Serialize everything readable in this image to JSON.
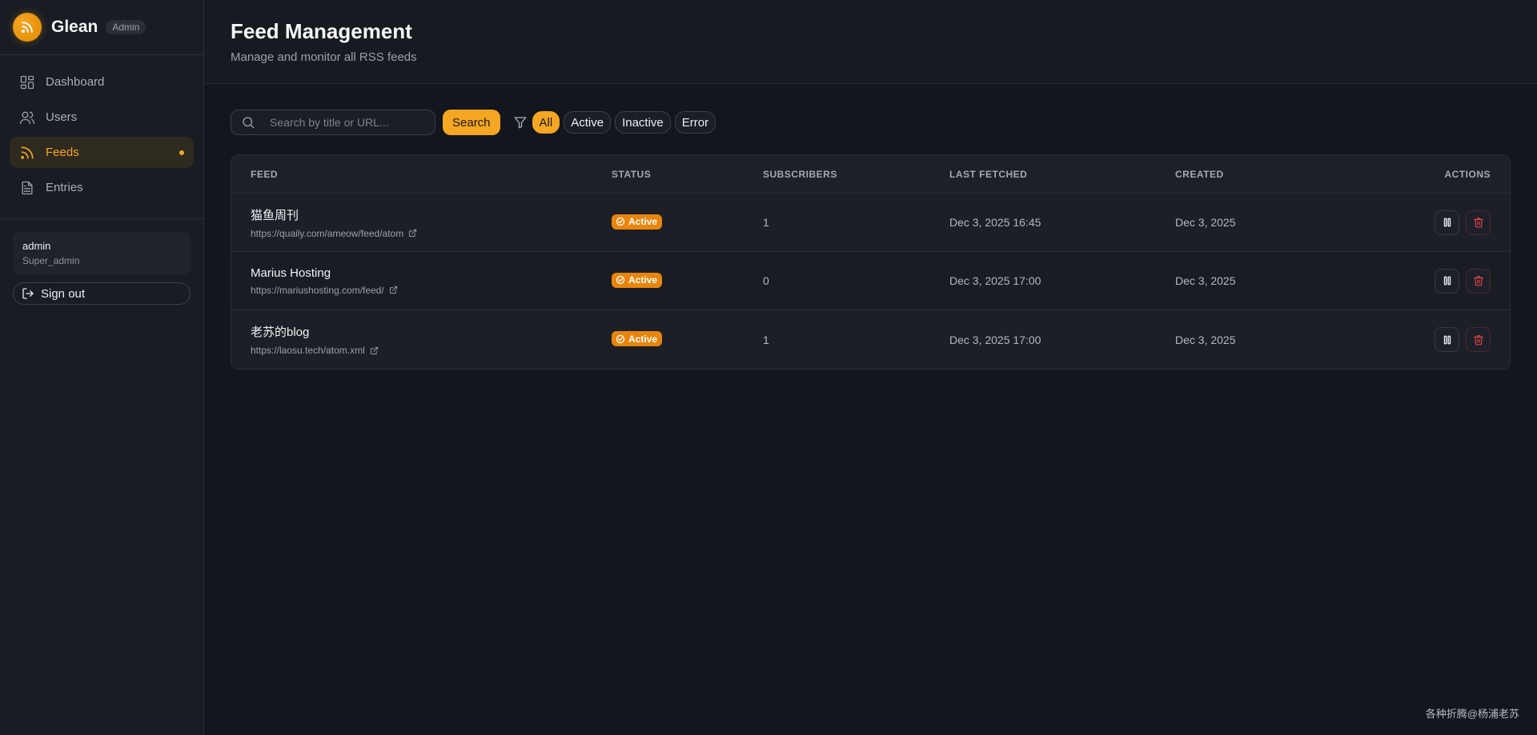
{
  "brand": {
    "name": "Glean",
    "badge": "Admin",
    "accent": "#f5a623"
  },
  "sidebar": {
    "items": [
      {
        "label": "Dashboard",
        "icon": "dashboard-icon",
        "active": false
      },
      {
        "label": "Users",
        "icon": "users-icon",
        "active": false
      },
      {
        "label": "Feeds",
        "icon": "rss-icon",
        "active": true
      },
      {
        "label": "Entries",
        "icon": "document-icon",
        "active": false
      }
    ],
    "user": {
      "name": "admin",
      "role": "Super_admin"
    },
    "signout_label": "Sign out"
  },
  "header": {
    "title": "Feed Management",
    "subtitle": "Manage and monitor all RSS feeds"
  },
  "toolbar": {
    "search_placeholder": "Search by title or URL...",
    "search_value": "",
    "search_button": "Search",
    "filters": [
      "All",
      "Active",
      "Inactive",
      "Error"
    ],
    "selected_filter": "All"
  },
  "table": {
    "columns": {
      "feed": "FEED",
      "status": "STATUS",
      "subscribers": "SUBSCRIBERS",
      "last_fetched": "LAST FETCHED",
      "created": "CREATED",
      "actions": "ACTIONS"
    },
    "rows": [
      {
        "title": "猫鱼周刊",
        "url": "https://quaily.com/ameow/feed/atom",
        "status": "Active",
        "subscribers": "1",
        "last_fetched": "Dec 3, 2025 16:45",
        "created": "Dec 3, 2025"
      },
      {
        "title": "Marius Hosting",
        "url": "https://mariushosting.com/feed/",
        "status": "Active",
        "subscribers": "0",
        "last_fetched": "Dec 3, 2025 17:00",
        "created": "Dec 3, 2025"
      },
      {
        "title": "老苏的blog",
        "url": "https://laosu.tech/atom.xml",
        "status": "Active",
        "subscribers": "1",
        "last_fetched": "Dec 3, 2025 17:00",
        "created": "Dec 3, 2025"
      }
    ]
  },
  "watermark": "各种折腾@杨浦老苏"
}
